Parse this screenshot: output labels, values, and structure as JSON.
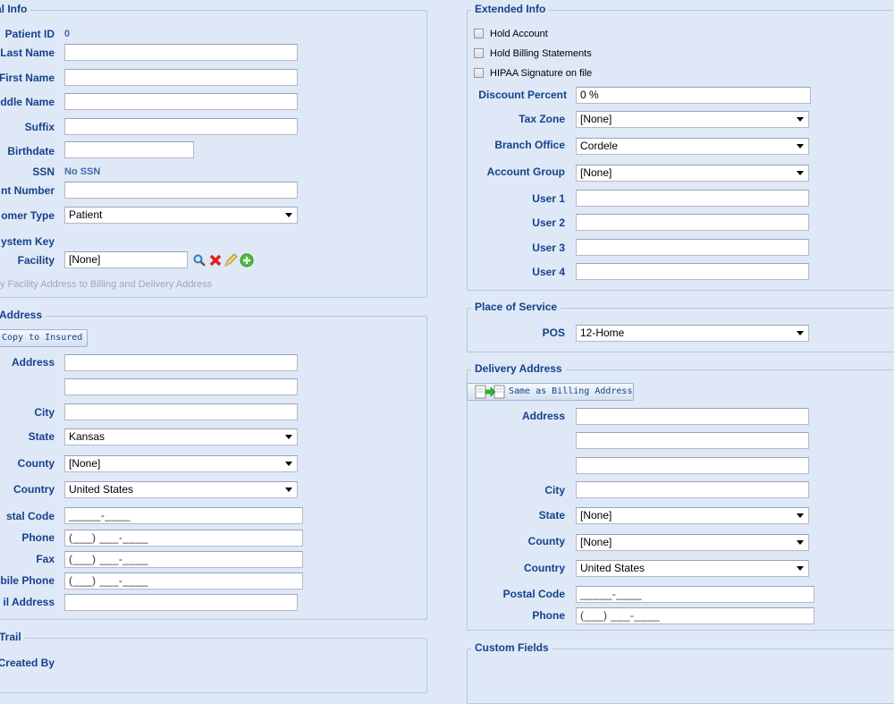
{
  "general": {
    "legend": "al Info",
    "patient_id_label": "Patient ID",
    "patient_id_value": "0",
    "last_name_label": "Last Name",
    "first_name_label": "First Name",
    "middle_name_label": "ddle Name",
    "suffix_label": "Suffix",
    "birthdate_label": "Birthdate",
    "ssn_label": "SSN",
    "ssn_value": "No SSN",
    "account_number_label": "nt Number",
    "customer_type_label": "omer Type",
    "customer_type_value": "Patient",
    "system_key_label": "ystem Key",
    "facility_label": "Facility",
    "facility_value": "[None]",
    "facility_hint": "y Facility Address to Billing and Delivery Address"
  },
  "billing": {
    "legend": "Address",
    "copy_button": "Copy to Insured",
    "address_label": "Address",
    "city_label": "City",
    "state_label": "State",
    "state_value": "Kansas",
    "county_label": "County",
    "county_value": "[None]",
    "country_label": "Country",
    "country_value": "United States",
    "postal_label": "stal Code",
    "postal_mask": "_____-____",
    "phone_label": "Phone",
    "phone_mask": "(___) ___-____",
    "fax_label": "Fax",
    "fax_mask": "(___) ___-____",
    "mobile_label": "bile Phone",
    "mobile_mask": "(___) ___-____",
    "email_label": "il Address"
  },
  "trail": {
    "legend": "Trail",
    "created_by_label": "Created By"
  },
  "extended": {
    "legend": "Extended Info",
    "hold_account": "Hold Account",
    "hold_billing": "Hold Billing Statements",
    "hipaa": "HIPAA Signature on file",
    "discount_label": "Discount Percent",
    "discount_value": "0 %",
    "tax_zone_label": "Tax Zone",
    "tax_zone_value": "[None]",
    "branch_label": "Branch Office",
    "branch_value": "Cordele",
    "account_group_label": "Account Group",
    "account_group_value": "[None]",
    "user1_label": "User 1",
    "user2_label": "User 2",
    "user3_label": "User 3",
    "user4_label": "User 4"
  },
  "pos": {
    "legend": "Place of Service",
    "pos_label": "POS",
    "pos_value": "12-Home"
  },
  "delivery": {
    "legend": "Delivery Address",
    "same_button": "Same as Billing Address",
    "address_label": "Address",
    "city_label": "City",
    "state_label": "State",
    "state_value": "[None]",
    "county_label": "County",
    "county_value": "[None]",
    "country_label": "Country",
    "country_value": "United States",
    "postal_label": "Postal Code",
    "postal_mask": "_____-____",
    "phone_label": "Phone",
    "phone_mask": "(___) ___-____"
  },
  "custom": {
    "legend": "Custom Fields"
  },
  "icons": [
    "search-icon",
    "delete-icon",
    "edit-icon",
    "add-icon",
    "copy-icon"
  ],
  "colors": {
    "background": "#dfe8f6",
    "label": "#15428b",
    "border": "#b5c7e0"
  }
}
